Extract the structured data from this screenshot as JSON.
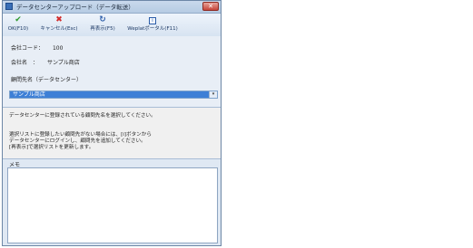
{
  "window": {
    "title": "データセンターアップロード（データ転送）",
    "close_label": "✕"
  },
  "toolbar": {
    "buttons": [
      {
        "label": "OK(F10)",
        "icon": "check-icon",
        "glyph": "✔"
      },
      {
        "label": "キャンセル(Esc)",
        "icon": "cross-icon",
        "glyph": "✖"
      },
      {
        "label": "再表示(F5)",
        "icon": "refresh-icon",
        "glyph": "↻"
      },
      {
        "label": "Weplatポータル(F11)",
        "icon": "info-icon",
        "glyph": "i"
      }
    ]
  },
  "form": {
    "company_code_label": "会社コード：",
    "company_code_value": "100",
    "company_name_label": "会社名　：",
    "company_name_value": "サンプル商店",
    "client_label": "顧問先名（データセンター）",
    "client_selected": "サンプル商店",
    "dropdown_arrow": "▾"
  },
  "messages": {
    "line1": "データセンターに登録されている顧問先名を選択してください。",
    "line2": "選択リストに登録したい顧問先がない場合には、[i]ボタンから",
    "line3": "データセンターにログインし、顧問先を追加してください。",
    "line4": "[再表示]で選択リストを更新します。"
  },
  "memo": {
    "label": "メモ",
    "value": ""
  },
  "colors": {
    "selection": "#3d7fd6",
    "window_border": "#6d87a6",
    "close_button": "#c6453a"
  }
}
